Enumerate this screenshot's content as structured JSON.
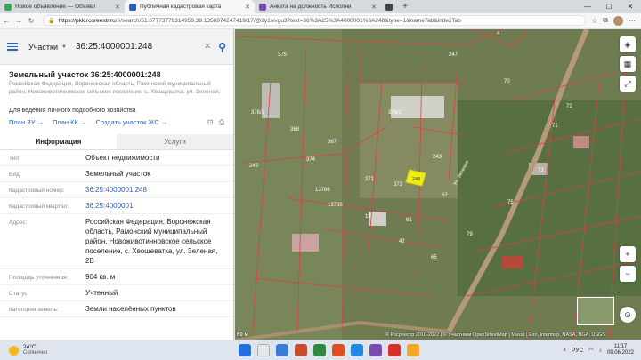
{
  "browser": {
    "tabs": [
      {
        "title": "Новое объявление — Объявл",
        "favicon_color": "#3aa757",
        "active": false
      },
      {
        "title": "Публичная кадастровая карта",
        "favicon_color": "#2a64b4",
        "active": true
      },
      {
        "title": "Анкета на должность Исполни",
        "favicon_color": "#7b4ab3",
        "active": false
      },
      {
        "title": "",
        "favicon_color": "#444444",
        "active": false
      }
    ],
    "new_tab": "+",
    "window_controls": [
      "—",
      "☐",
      "✕"
    ],
    "url_host": "https://pkk.rosreestr.ru",
    "url_path": "/#/search/51.87773779314959,39.1358974247419/17/@2y1wvgu3?text=36%3A25%3A4000001%3A248&type=1&nameTab&indexTab",
    "nav": [
      "←",
      "→",
      "↻"
    ]
  },
  "search": {
    "type_label": "Участки",
    "value": "36:25:4000001:248"
  },
  "object": {
    "title": "Земельный участок 36:25:4000001:248",
    "address_line": "Российская Федерация, Воронежская область, Рамонский муниципальный район, Новоживотинновское сельское поселение, с. Хвощеватка, ул. Зеленая, ...",
    "purpose": "Для ведения личного подсобного хозяйства",
    "links": [
      "План ЗУ →",
      "План КК →",
      "Создать участок ЖС →"
    ]
  },
  "tabs": {
    "info": "Информация",
    "services": "Услуги"
  },
  "fields": [
    {
      "label": "Тип:",
      "value": "Объект недвижимости",
      "link": false
    },
    {
      "label": "Вид:",
      "value": "Земельный участок",
      "link": false
    },
    {
      "label": "Кадастровый номер:",
      "value": "36:25:4000001:248",
      "link": true
    },
    {
      "label": "Кадастровый квартал:",
      "value": "36:25:4000001",
      "link": true
    },
    {
      "label": "Адрес:",
      "value": "Российская Федерация, Воронежская область, Рамонский муниципальный район, Новоживотинновское сельское поселение, с. Хвощеватка, ул. Зеленая, 2В",
      "link": false
    },
    {
      "label": "Площадь уточненная:",
      "value": "904 кв. м",
      "link": false
    },
    {
      "label": "Статус:",
      "value": "Учтенный",
      "link": false
    },
    {
      "label": "Категория земель:",
      "value": "Земли населённых пунктов",
      "link": false
    }
  ],
  "map": {
    "parcel_labels": [
      "375",
      "376/2",
      "376/1",
      "368",
      "367",
      "245",
      "374",
      "371",
      "373",
      "13786",
      "13786",
      "13",
      "42",
      "61",
      "62",
      "65",
      "248",
      "243",
      "247",
      "70",
      "71",
      "72",
      "73",
      "75",
      "79",
      "4"
    ],
    "street_label": "Ул. Зеленая",
    "highlight_label": "248",
    "scale": "60 м",
    "attribution": "© Росреестр 2010-2022 | © Участники OpenStreetMap | Maxar | Esri, Intermap, NASA, NGA, USGS",
    "buttons": [
      "◈",
      "▦",
      "⤢",
      "+",
      "−",
      "⊙"
    ]
  },
  "taskbar": {
    "temp": "24°C",
    "weather": "Солнечно",
    "lang": "РУС",
    "time": "11:17",
    "date": "09.06.2022",
    "icons": [
      "#1f6fe0",
      "#e8e8e8",
      "#3a7bd5",
      "#c84b2b",
      "#2b8a3e",
      "#e04e1f",
      "#1e88e5",
      "#7b4ab3",
      "#d93025",
      "#f5a623"
    ]
  }
}
